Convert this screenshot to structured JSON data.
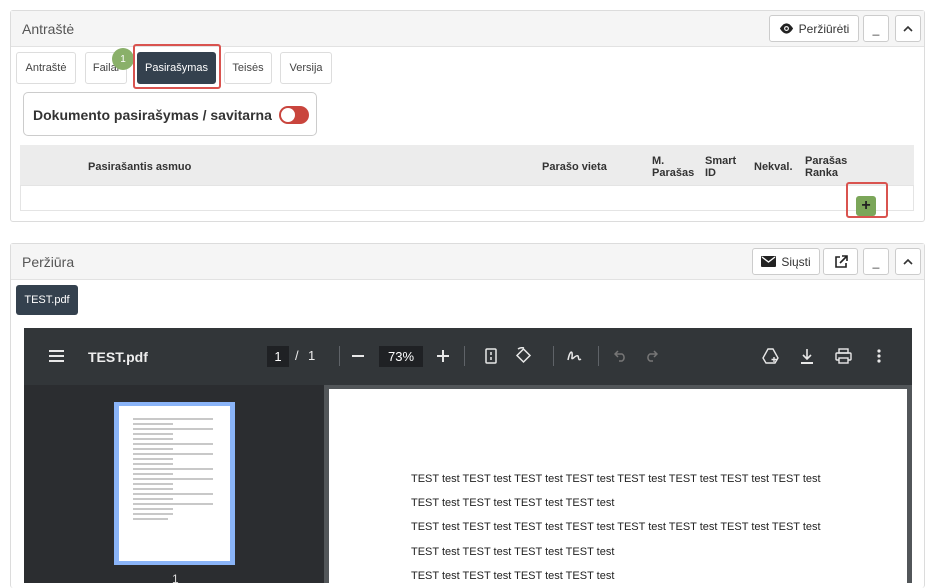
{
  "top_panel": {
    "title": "Antraštė",
    "preview_label": "Peržiūrėti",
    "minimize_label": "_",
    "collapse_label": "^",
    "tabs": [
      {
        "label": "Antraštė"
      },
      {
        "label": "Failai"
      },
      {
        "label": "Pasirašymas"
      },
      {
        "label": "Teisės"
      },
      {
        "label": "Versija"
      }
    ],
    "files_badge": "1",
    "active_tab": "Pasirašymas",
    "toggle_label": "Dokumento pasirašymas / savitarna",
    "toggle_on": false,
    "table": {
      "col_person": "Pasirašantis asmuo",
      "col_place": "Parašo vieta",
      "col_m_sign": "M. Parašas",
      "col_smart_id": "Smart ID",
      "col_nekval": "Nekval.",
      "col_hand": "Parašas Ranka"
    },
    "add_label": "+"
  },
  "preview_panel": {
    "title": "Peržiūra",
    "send_label": "Siųsti",
    "minimize_label": "_",
    "collapse_label": "^",
    "file_label": "TEST.pdf"
  },
  "pdf_viewer": {
    "filename": "TEST.pdf",
    "current_page": "1",
    "page_separator": "/",
    "total_pages": "1",
    "zoom": "73%",
    "thumbnail_page": "1",
    "lines": [
      "TEST test TEST test TEST test TEST test TEST test TEST test TEST test TEST test",
      "TEST test TEST test TEST test TEST test",
      "TEST test TEST test TEST test TEST test TEST test TEST test TEST test TEST test",
      "TEST test TEST test TEST test TEST test",
      "TEST test TEST test TEST test TEST test"
    ]
  },
  "colors": {
    "active_tab": "#34414e",
    "badge": "#8ab06a",
    "highlight": "#d9534f",
    "toggle_off": "#c9453d",
    "add_button": "#7ba659",
    "viewer_toolbar": "#323639"
  },
  "icons": [
    "eye-icon",
    "envelope-icon",
    "external-link-icon",
    "menu-icon",
    "minus-icon",
    "plus-icon",
    "fit-page-icon",
    "rotate-icon",
    "draw-icon",
    "undo-icon",
    "redo-icon",
    "drive-icon",
    "download-icon",
    "print-icon",
    "more-icon"
  ]
}
